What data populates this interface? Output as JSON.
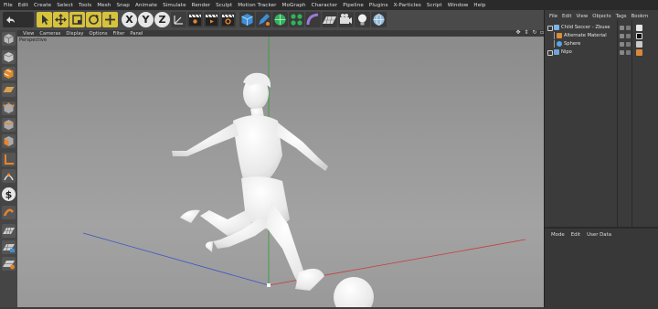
{
  "menubar": {
    "items": [
      "File",
      "Edit",
      "Create",
      "Select",
      "Tools",
      "Mesh",
      "Snap",
      "Animate",
      "Simulate",
      "Render",
      "Sculpt",
      "Motion Tracker",
      "MoGraph",
      "Character",
      "Pipeline",
      "Plugins",
      "X-Particles",
      "Script",
      "Window",
      "Help"
    ]
  },
  "toolbar": {
    "axis_x": "X",
    "axis_y": "Y",
    "axis_z": "Z"
  },
  "viewport": {
    "menu": [
      "View",
      "Cameras",
      "Display",
      "Options",
      "Filter",
      "Panel"
    ],
    "label": "Perspective"
  },
  "object_manager": {
    "tabs": [
      "File",
      "Edit",
      "View",
      "Objects",
      "Tags",
      "Bookm"
    ],
    "objects": [
      {
        "name": "Child Soccer - Zbuse"
      },
      {
        "name": "Alternate Material"
      },
      {
        "name": "Sphere"
      },
      {
        "name": "Nipo"
      }
    ]
  },
  "attribute_manager": {
    "tabs": [
      "Mode",
      "Edit",
      "User Data"
    ]
  },
  "colors": {
    "x_axis": "#c83a3a",
    "y_axis": "#2ea02e",
    "z_axis": "#3a52c8",
    "selection": "#4a6fa5"
  }
}
